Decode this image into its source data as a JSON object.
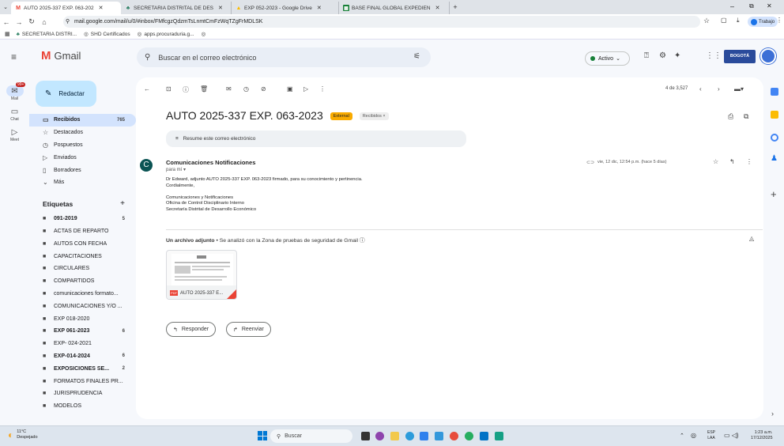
{
  "browser": {
    "tabs": [
      {
        "title": "AUTO 2025-337 EXP. 063-202",
        "icon": "gmail-icon",
        "color": "#ea4335",
        "active": true
      },
      {
        "title": "SECRETARIA DISTRITAL DE DES",
        "icon": "sdh-icon",
        "color": "#2a7f62"
      },
      {
        "title": "EXP 052-2023 - Google Drive",
        "icon": "drive-icon",
        "color": "#fbbc04"
      },
      {
        "title": "BASE FINAL GLOBAL EXPEDIEN",
        "icon": "sheets-icon",
        "color": "#188038"
      }
    ],
    "new_tab": "+",
    "url": "mail.google.com/mail/u/0/#inbox/FMfcgzQdzmTsLnmtCmFzWqTZgFrMDLSK",
    "profile": "Trabajo",
    "bookmarks": [
      "SECRETARIA DISTRI...",
      "SHD Certificados",
      "apps.procuraduria.g..."
    ]
  },
  "gmail": {
    "logo": "Gmail",
    "search_placeholder": "Buscar en el correo electrónico",
    "status": "Activo",
    "org_logo": "BOGOTÁ",
    "compose": "Redactar",
    "rail": [
      {
        "label": "Mail",
        "icon": "mail-icon",
        "badge": "99+"
      },
      {
        "label": "Chat",
        "icon": "chat-icon"
      },
      {
        "label": "Meet",
        "icon": "meet-icon"
      }
    ],
    "nav": [
      {
        "label": "Recibidos",
        "count": "765",
        "icon": "inbox-icon",
        "selected": true
      },
      {
        "label": "Destacados",
        "icon": "star-icon"
      },
      {
        "label": "Pospuestos",
        "icon": "clock-icon"
      },
      {
        "label": "Enviados",
        "icon": "send-icon"
      },
      {
        "label": "Borradores",
        "icon": "draft-icon"
      },
      {
        "label": "Más",
        "icon": "chevron-down-icon"
      }
    ],
    "labels_title": "Etiquetas",
    "labels": [
      {
        "label": "091-2019",
        "count": "5",
        "bold": true
      },
      {
        "label": "ACTAS DE REPARTO"
      },
      {
        "label": "AUTOS CON FECHA"
      },
      {
        "label": "CAPACITACIONES"
      },
      {
        "label": "CIRCULARES"
      },
      {
        "label": "COMPARTIDOS"
      },
      {
        "label": "comunicaciones formato..."
      },
      {
        "label": "COMUNICACIONES Y/O ..."
      },
      {
        "label": "EXP 018-2020"
      },
      {
        "label": "EXP 061-2023",
        "count": "6",
        "bold": true
      },
      {
        "label": "EXP- 024-2021"
      },
      {
        "label": "EXP-014-2024",
        "count": "6",
        "bold": true
      },
      {
        "label": "EXPOSICIONES SE...",
        "count": "2",
        "bold": true
      },
      {
        "label": "FORMATOS FINALES PR..."
      },
      {
        "label": "JURISPRUDENCIA"
      },
      {
        "label": "MODELOS"
      }
    ],
    "pager": "4 de 3,527",
    "email": {
      "subject": "AUTO 2025-337 EXP. 063-2023",
      "tag_external": "External",
      "tag_inbox": "Recibidos",
      "summary": "Resume este correo electrónico",
      "sender": "Comunicaciones Notificaciones",
      "avatar_letter": "C",
      "to": "para mí",
      "date": "vie, 12 dic, 12:54 p.m. (hace 5 días)",
      "body": [
        "Dr Edward, adjunto AUTO 2025-337 EXP. 063-2023 firmado, para su conocimiento y pertinencia.",
        "Cordialmente,",
        "",
        "Comunicaciones y Notificaciones",
        "Oficina de Control Disciplinario Interno",
        "Secretaría Distrital de Desarrollo Económico"
      ],
      "attachment_header": "Un archivo adjunto",
      "attachment_note": " • Se analizó con la Zona de pruebas de seguridad de Gmail ⓘ",
      "attachment_name": "AUTO 2025-337 E...",
      "reply": "Responder",
      "forward": "Reenviar"
    }
  },
  "taskbar": {
    "weather_temp": "11°C",
    "weather_desc": "Despejado",
    "search": "Buscar",
    "lang": "ESP",
    "lang2": "LAA",
    "time": "1:23 a.m.",
    "date": "17/12/2025"
  }
}
